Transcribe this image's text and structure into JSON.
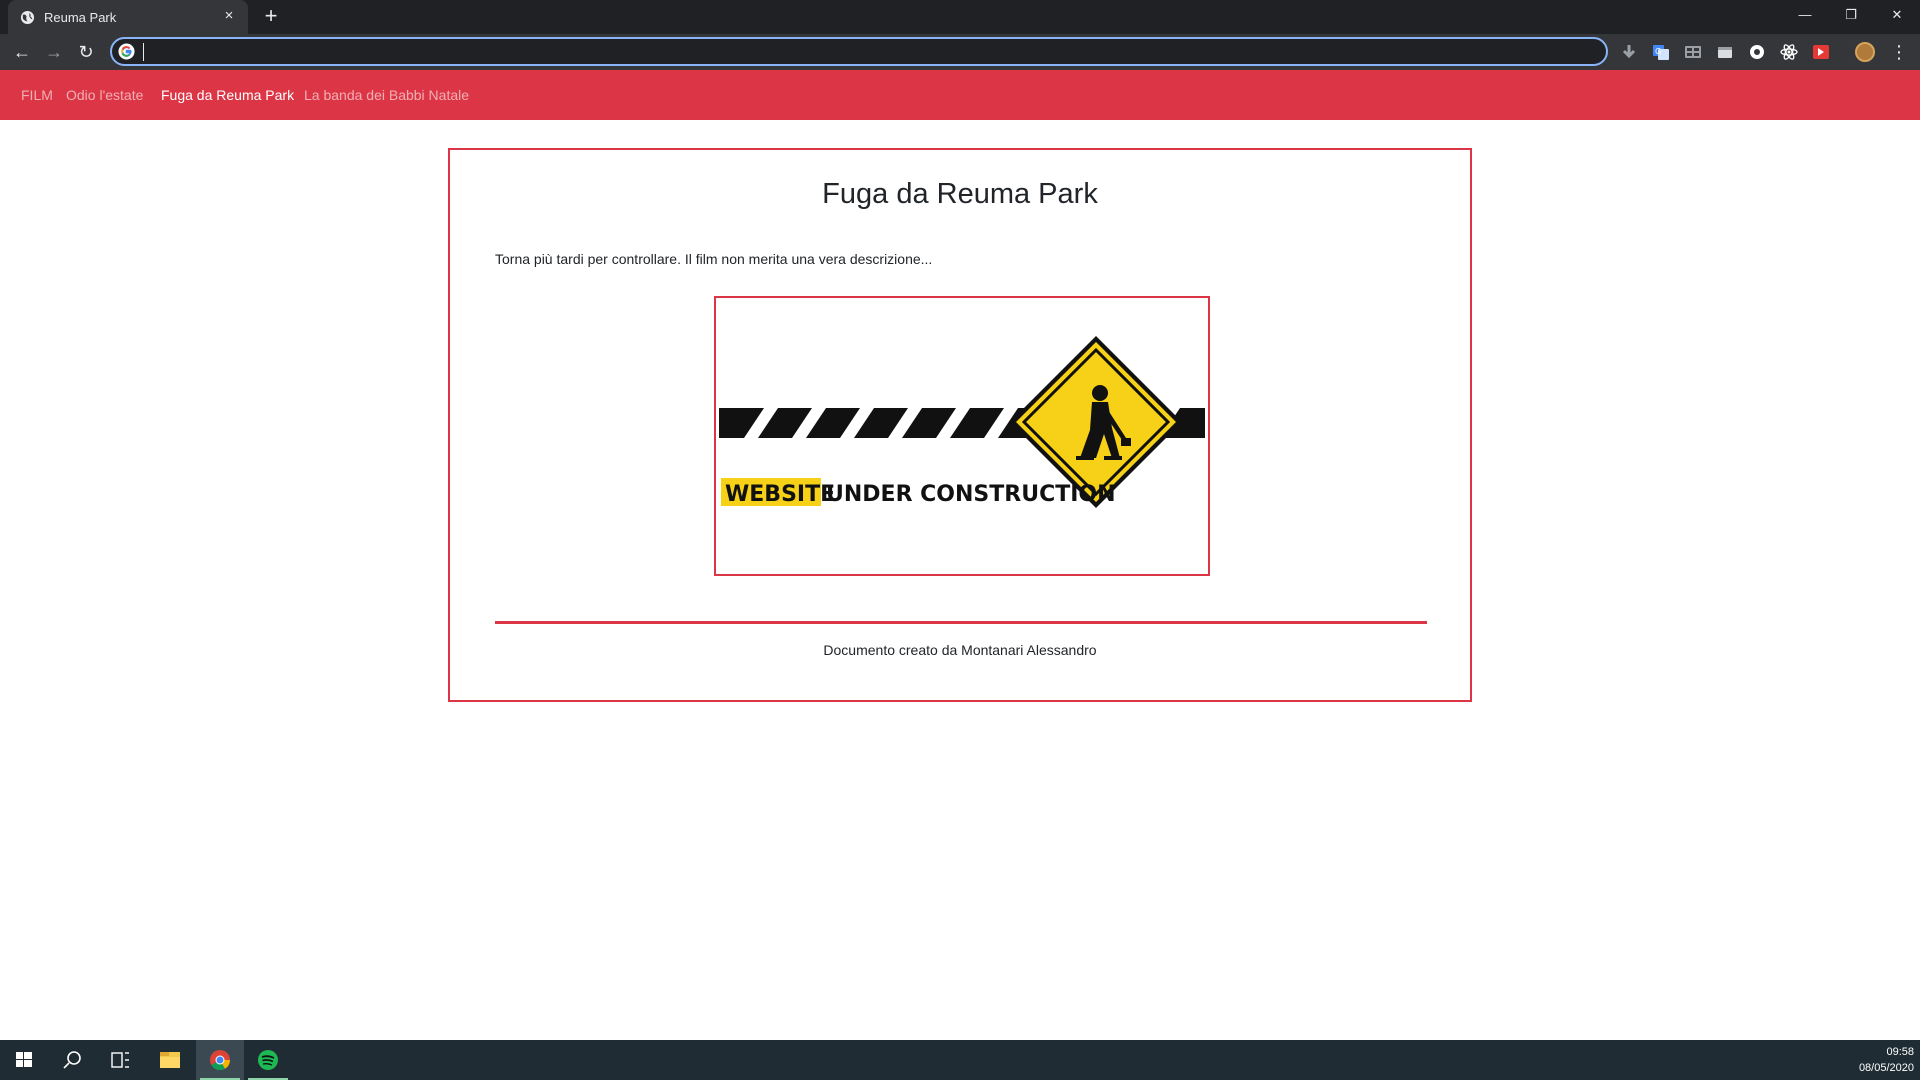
{
  "browser": {
    "tab_title": "Reuma Park",
    "address_value": "",
    "tab_close_glyph": "×",
    "new_tab_glyph": "+",
    "controls": {
      "minimize": "—",
      "restore": "❐",
      "close": "✕"
    },
    "nav": {
      "back": "←",
      "forward": "→",
      "reload": "↻",
      "menu": "⋮"
    }
  },
  "site": {
    "nav": {
      "brand": "FILM",
      "items": [
        {
          "label": "Odio l'estate",
          "active": false
        },
        {
          "label": "Fuga da Reuma Park",
          "active": true
        },
        {
          "label": "La banda dei Babbi Natale",
          "active": false
        }
      ]
    },
    "title": "Fuga da Reuma Park",
    "description": "Torna più tardi per controllare. Il film non merita una vera descrizione...",
    "image": {
      "word_highlight": "WEBSITE",
      "word_rest": "UNDER CONSTRUCTION"
    },
    "footer": "Documento creato da Montanari Alessandro"
  },
  "taskbar": {
    "time": "09:58",
    "date": "08/05/2020"
  },
  "colors": {
    "accent": "#dc3545",
    "sign_yellow": "#f7d117",
    "chrome_dark": "#202124",
    "chrome_mid": "#35363a",
    "taskbar": "#1f2c33"
  }
}
